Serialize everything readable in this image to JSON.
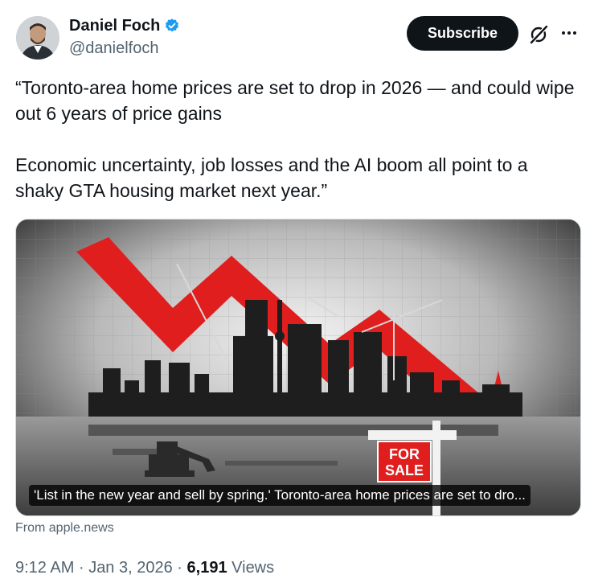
{
  "author": {
    "display_name": "Daniel Foch",
    "handle": "@danielfoch",
    "verified": true,
    "avatar_icon": "person-avatar"
  },
  "actions": {
    "subscribe_label": "Subscribe",
    "grok_icon": "grok-icon",
    "more_icon": "more-icon"
  },
  "tweet": {
    "paragraph_1": "“Toronto-area home prices are set to drop in 2026 — and could wipe out 6 years of price gains",
    "paragraph_2": "Economic uncertainty, job losses and the AI boom all point to a shaky GTA housing market next year.”"
  },
  "card": {
    "title": "'List in the new year and sell by spring.' Toronto-area home prices are set to dro...",
    "sign_text_1": "FOR",
    "sign_text_2": "SALE",
    "source": "From apple.news"
  },
  "meta": {
    "time": "9:12 AM",
    "separator": "·",
    "date": "Jan 3, 2026",
    "views_count": "6,191",
    "views_label": "Views"
  },
  "colors": {
    "accent_blue": "#1d9bf0",
    "text_primary": "#0f1419",
    "text_secondary": "#536471",
    "arrow_red": "#e01e1e"
  }
}
